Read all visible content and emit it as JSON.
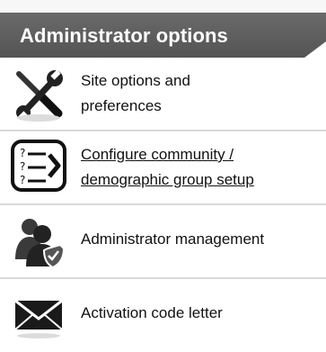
{
  "header": {
    "title": "Administrator options"
  },
  "items": [
    {
      "label_line1": "Site options and",
      "label_line2": "preferences",
      "icon": "tools-icon"
    },
    {
      "label_line1": "Configure community /",
      "label_line2": "demographic group setup",
      "icon": "question-list-icon"
    },
    {
      "label_line1": "Administrator management",
      "icon": "admin-users-icon"
    },
    {
      "label_line1": "Activation code letter",
      "icon": "envelope-icon"
    }
  ]
}
